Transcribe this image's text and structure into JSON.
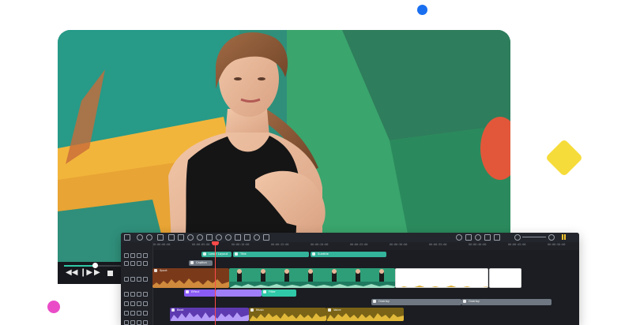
{
  "colors": {
    "accent_teal": "#2fc8a8",
    "accent_purple": "#8a5cf5",
    "accent_gold": "#d8a92a",
    "accent_orange": "#b2581e",
    "playhead": "#ff4a4a",
    "editor_bg": "#1b1d22"
  },
  "decor": {
    "dot_blue": "blue-dot",
    "dot_pink": "pink-dot",
    "diamond": "yellow-diamond"
  },
  "preview": {
    "subject": "photo-running-woman",
    "playback_progress": 0.25
  },
  "player_controls": [
    "step-back-icon",
    "frame-back-icon",
    "play-icon",
    "stop-icon"
  ],
  "toolbar": {
    "left_icons": [
      "menu-icon",
      "undo-icon",
      "redo-icon",
      "delete-icon",
      "split-icon",
      "crop-icon",
      "speed-icon",
      "color-icon",
      "keyframe-icon",
      "audio-icon",
      "timer-icon",
      "freeze-icon",
      "transform-icon",
      "mask-icon",
      "text-icon"
    ],
    "right_icons": [
      "render-icon",
      "marker-icon",
      "mic-icon",
      "ai-icon",
      "snapshot-icon",
      "zoom-out-icon",
      "zoom-in-icon"
    ]
  },
  "timeline": {
    "ruler_labels": [
      "00:00:00:00",
      "00:00:05:00",
      "00:00:10:00",
      "00:00:15:00",
      "00:00:20:00",
      "00:00:25:00",
      "00:00:30:00",
      "00:00:35:00",
      "00:00:40:00",
      "00:00:45:00",
      "00:00:50:00"
    ],
    "clips": {
      "title_a": "Lower Layout",
      "title_b": "Title",
      "title_c": "Subtitle",
      "caption": "Caption",
      "main_video": "Sport",
      "effect_a": "Effect",
      "effect_b": "Filter",
      "sticker_a": "Sticker",
      "audio_a": "Beat",
      "audio_b": "Music",
      "audio_c": "Voice",
      "grey_a": "Overlay",
      "grey_b": "Overlay"
    }
  }
}
